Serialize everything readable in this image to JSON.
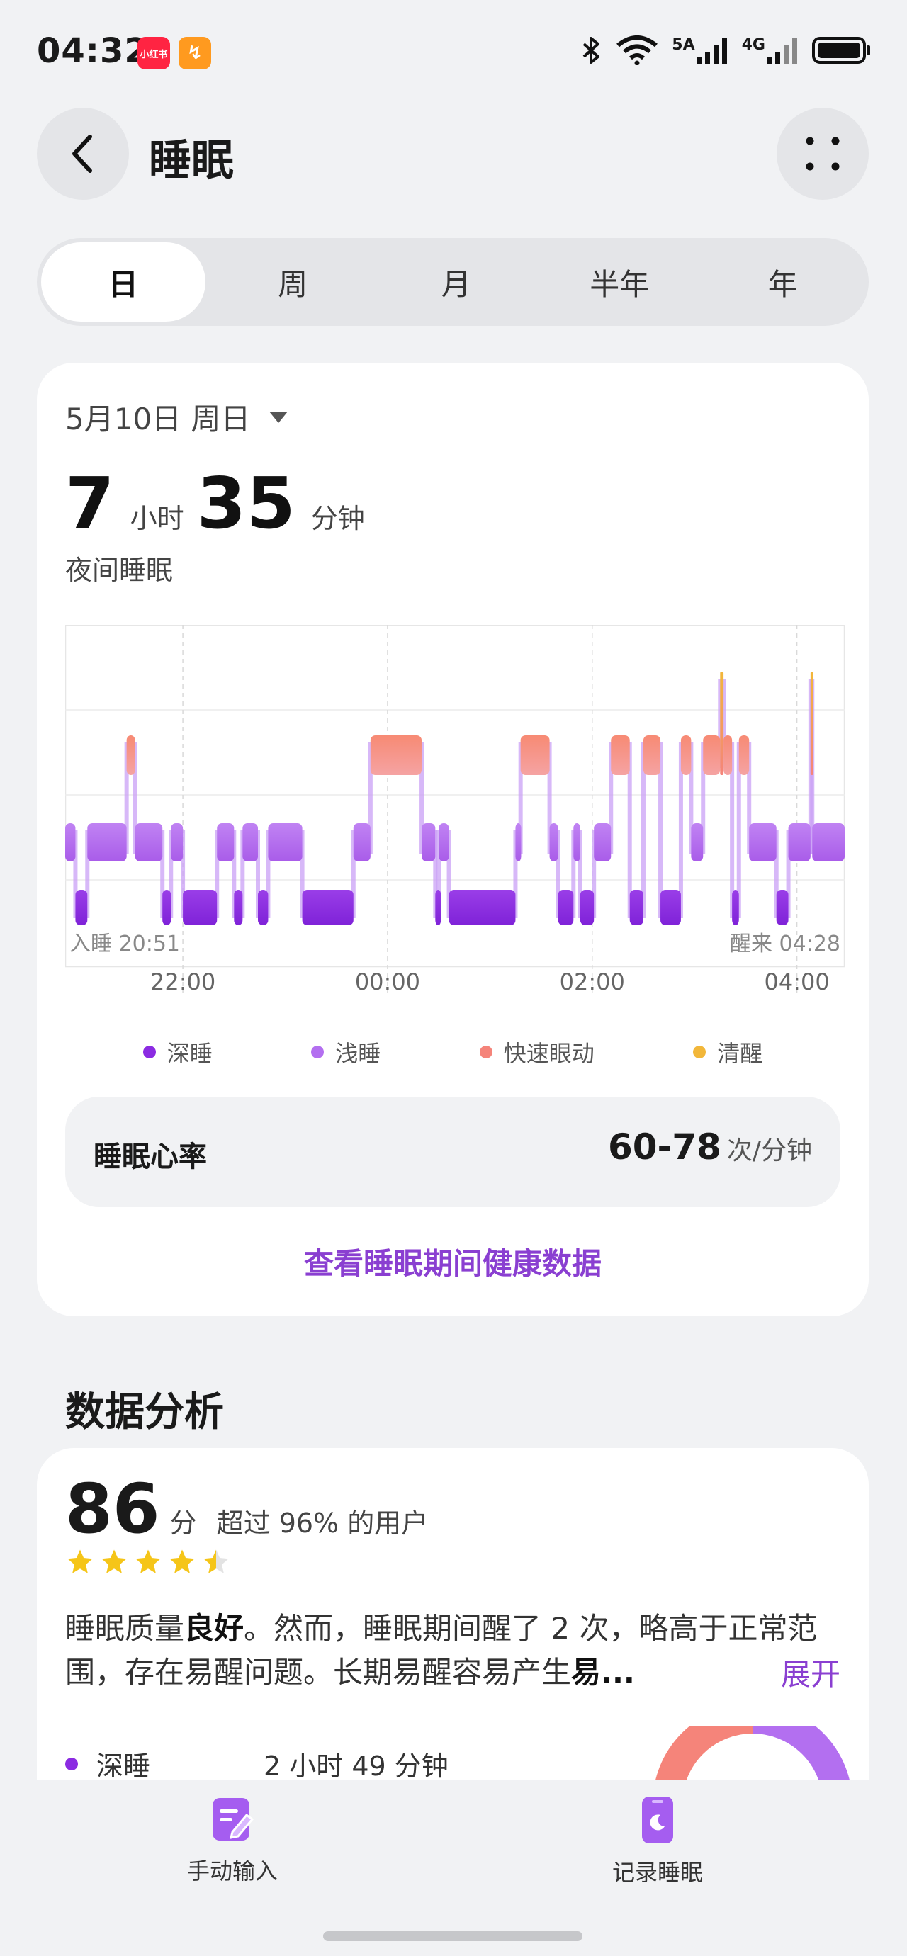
{
  "status_bar": {
    "time": "04:32",
    "app_badges": [
      "小红书",
      "↯"
    ],
    "network_5g": "5A",
    "network_4g": "4G",
    "icons": [
      "bluetooth-icon",
      "wifi-icon",
      "signal-icon",
      "battery-icon"
    ]
  },
  "header": {
    "title": "睡眠",
    "back_icon": "chevron-left-icon",
    "more_icon": "grid-dots-icon"
  },
  "tabs": [
    "日",
    "周",
    "月",
    "半年",
    "年"
  ],
  "summary": {
    "date": "5月10日 周日",
    "hours": "7",
    "hours_unit": "小时",
    "minutes": "35",
    "minutes_unit": "分钟",
    "label": "夜间睡眠"
  },
  "chart_data": {
    "type": "hypnogram",
    "start_label": "入睡 20:51",
    "end_label": "醒来 04:28",
    "x_ticks": [
      "22:00",
      "00:00",
      "02:00",
      "04:00"
    ],
    "stages": [
      "清醒",
      "快速眼动",
      "浅睡",
      "深睡"
    ],
    "colors": {
      "深睡": "#8b2be2",
      "浅睡": "#b36ff0",
      "快速眼动": "#f5847a",
      "清醒": "#f2b73a"
    },
    "segments": [
      [
        "20:51",
        "20:57",
        "浅睡"
      ],
      [
        "20:57",
        "21:04",
        "深睡"
      ],
      [
        "21:04",
        "21:27",
        "浅睡"
      ],
      [
        "21:27",
        "21:32",
        "快速眼动"
      ],
      [
        "21:32",
        "21:48",
        "浅睡"
      ],
      [
        "21:48",
        "21:53",
        "深睡"
      ],
      [
        "21:53",
        "22:00",
        "浅睡"
      ],
      [
        "22:00",
        "22:20",
        "深睡"
      ],
      [
        "22:20",
        "22:30",
        "浅睡"
      ],
      [
        "22:30",
        "22:35",
        "深睡"
      ],
      [
        "22:35",
        "22:44",
        "浅睡"
      ],
      [
        "22:44",
        "22:50",
        "深睡"
      ],
      [
        "22:50",
        "23:10",
        "浅睡"
      ],
      [
        "23:10",
        "23:40",
        "深睡"
      ],
      [
        "23:40",
        "23:50",
        "浅睡"
      ],
      [
        "23:50",
        "00:20",
        "快速眼动"
      ],
      [
        "00:20",
        "00:28",
        "浅睡"
      ],
      [
        "00:28",
        "00:30",
        "深睡"
      ],
      [
        "00:30",
        "00:36",
        "浅睡"
      ],
      [
        "00:36",
        "01:15",
        "深睡"
      ],
      [
        "01:15",
        "01:18",
        "浅睡"
      ],
      [
        "01:18",
        "01:35",
        "快速眼动"
      ],
      [
        "01:35",
        "01:40",
        "浅睡"
      ],
      [
        "01:40",
        "01:49",
        "深睡"
      ],
      [
        "01:49",
        "01:53",
        "浅睡"
      ],
      [
        "01:53",
        "02:01",
        "深睡"
      ],
      [
        "02:01",
        "02:11",
        "浅睡"
      ],
      [
        "02:11",
        "02:22",
        "快速眼动"
      ],
      [
        "02:22",
        "02:30",
        "深睡"
      ],
      [
        "02:30",
        "02:40",
        "快速眼动"
      ],
      [
        "02:40",
        "02:52",
        "深睡"
      ],
      [
        "02:52",
        "02:58",
        "快速眼动"
      ],
      [
        "02:58",
        "03:05",
        "浅睡"
      ],
      [
        "03:05",
        "03:15",
        "快速眼动"
      ],
      [
        "03:15",
        "03:17",
        "清醒"
      ],
      [
        "03:17",
        "03:22",
        "快速眼动"
      ],
      [
        "03:22",
        "03:26",
        "深睡"
      ],
      [
        "03:26",
        "03:32",
        "快速眼动"
      ],
      [
        "03:32",
        "03:48",
        "浅睡"
      ],
      [
        "03:48",
        "03:55",
        "深睡"
      ],
      [
        "03:55",
        "04:08",
        "浅睡"
      ],
      [
        "04:08",
        "04:09",
        "清醒"
      ],
      [
        "04:09",
        "04:28",
        "浅睡"
      ]
    ],
    "range_start": "20:51",
    "range_end": "04:28",
    "grid": true
  },
  "legend": [
    {
      "label": "深睡",
      "color": "#8b2be2"
    },
    {
      "label": "浅睡",
      "color": "#b36ff0"
    },
    {
      "label": "快速眼动",
      "color": "#f5847a"
    },
    {
      "label": "清醒",
      "color": "#f2b73a"
    }
  ],
  "heart_rate": {
    "label": "睡眠心率",
    "value": "60-78",
    "unit": "次/分钟"
  },
  "link": "查看睡眠期间健康数据",
  "analysis": {
    "section_title": "数据分析",
    "score": "86",
    "score_unit": "分",
    "score_desc": "超过 96% 的用户",
    "stars": 4.5,
    "text_1": "睡眠质量",
    "text_bold_1": "良好",
    "text_2": "。然而，睡眠期间醒了 2 次，略高于正常范围，存在易醒问题。长期易醒容易产生",
    "text_bold_2": "易...",
    "expand": "展开",
    "deep_label": "深睡",
    "deep_value": "2 小时 49 分钟"
  },
  "bottom_bar": {
    "manual_input": "手动输入",
    "record_sleep": "记录睡眠"
  }
}
